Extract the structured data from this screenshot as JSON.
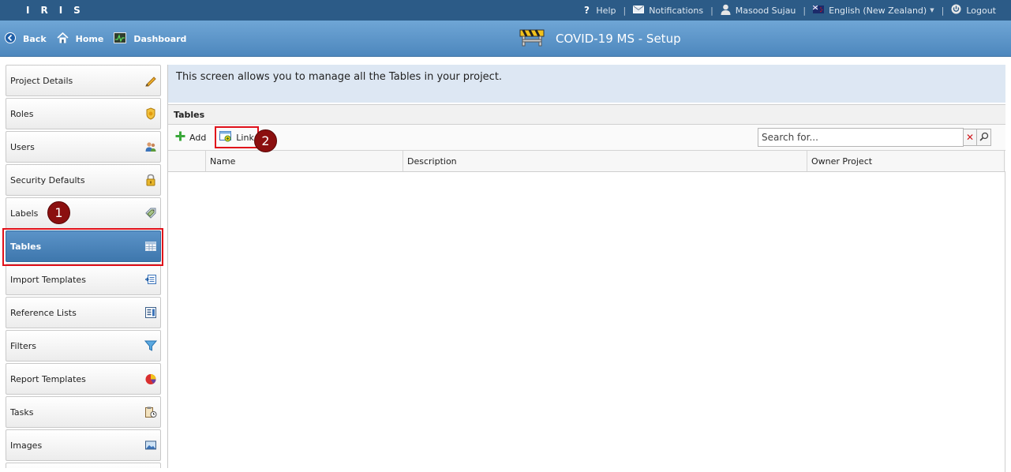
{
  "topbar": {
    "logo": "IRIS",
    "help": "Help",
    "notifications": "Notifications",
    "user": "Masood Sujau",
    "language": "English (New Zealand)",
    "logout": "Logout"
  },
  "header": {
    "back": "Back",
    "home": "Home",
    "dashboard": "Dashboard",
    "title": "COVID-19 MS - Setup"
  },
  "sidebar": {
    "items": [
      {
        "label": "Project Details",
        "icon": "pencil-icon"
      },
      {
        "label": "Roles",
        "icon": "badge-icon"
      },
      {
        "label": "Users",
        "icon": "users-icon"
      },
      {
        "label": "Security Defaults",
        "icon": "lock-icon"
      },
      {
        "label": "Labels",
        "icon": "label-tags-icon"
      },
      {
        "label": "Tables",
        "icon": "table-icon",
        "active": true
      },
      {
        "label": "Import Templates",
        "icon": "import-icon"
      },
      {
        "label": "Reference Lists",
        "icon": "reference-list-icon"
      },
      {
        "label": "Filters",
        "icon": "funnel-icon"
      },
      {
        "label": "Report Templates",
        "icon": "pie-chart-icon"
      },
      {
        "label": "Tasks",
        "icon": "clipboard-clock-icon"
      },
      {
        "label": "Images",
        "icon": "image-icon"
      }
    ]
  },
  "annotations": {
    "one": "1",
    "two": "2"
  },
  "main": {
    "info_text": "This screen allows you to manage all the Tables in your project.",
    "panel_title": "Tables",
    "toolbar": {
      "add": "Add",
      "link": "Link"
    },
    "search": {
      "placeholder": "Search for...",
      "clear": "✕"
    },
    "columns": [
      "",
      "Name",
      "Description",
      "Owner Project"
    ]
  },
  "colors": {
    "topbar": "#2c5b87",
    "header": "#4d87bd",
    "active_item": "#3e77ad",
    "highlight": "#e0101a",
    "badge": "#8b0f0f"
  }
}
